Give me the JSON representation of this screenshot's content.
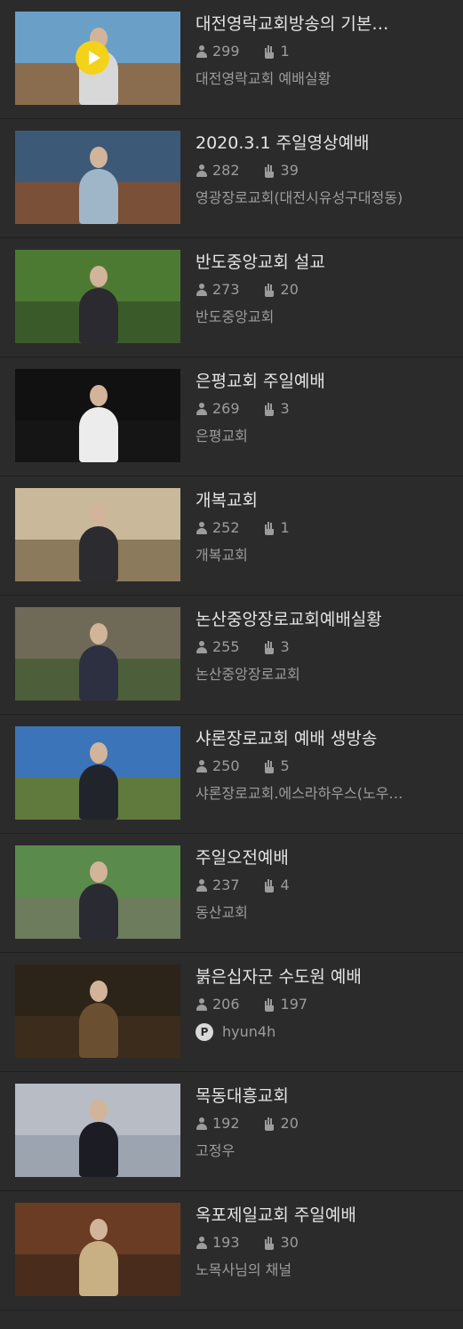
{
  "videos": [
    {
      "title": "대전영락교회방송의 기본…",
      "viewers": "299",
      "likes": "1",
      "channel": "대전영락교회 예배실황",
      "play": true,
      "colors": {
        "sky": "#6aa0c8",
        "ground": "#8a6d4e",
        "person": "#d8d8d8"
      }
    },
    {
      "title": "2020.3.1 주일영상예배",
      "viewers": "282",
      "likes": "39",
      "channel": "영광장로교회(대전시유성구대정동)",
      "colors": {
        "sky": "#3c5a78",
        "ground": "#7a5038",
        "person": "#9fb6c8"
      }
    },
    {
      "title": "반도중앙교회 설교",
      "viewers": "273",
      "likes": "20",
      "channel": "반도중앙교회",
      "colors": {
        "sky": "#4d7a32",
        "ground": "#3a5a2a",
        "person": "#2a2a30"
      }
    },
    {
      "title": "은평교회 주일예배",
      "viewers": "269",
      "likes": "3",
      "channel": "은평교회",
      "colors": {
        "sky": "#111111",
        "ground": "#151515",
        "person": "#ececec"
      }
    },
    {
      "title": "개복교회",
      "viewers": "252",
      "likes": "1",
      "channel": "개복교회",
      "colors": {
        "sky": "#c9b99a",
        "ground": "#8c7a5c",
        "person": "#2c2c30"
      }
    },
    {
      "title": "논산중앙장로교회예배실황",
      "viewers": "255",
      "likes": "3",
      "channel": "논산중앙장로교회",
      "colors": {
        "sky": "#6f6a58",
        "ground": "#4d5e3a",
        "person": "#2c3040"
      }
    },
    {
      "title": "샤론장로교회 예배 생방송",
      "viewers": "250",
      "likes": "5",
      "channel": "샤론장로교회.에스라하우스(노우…",
      "colors": {
        "sky": "#3b74b8",
        "ground": "#5f7a3c",
        "person": "#22242c"
      }
    },
    {
      "title": "주일오전예배",
      "viewers": "237",
      "likes": "4",
      "channel": "동산교회",
      "colors": {
        "sky": "#5a8a4c",
        "ground": "#6c7c5c",
        "person": "#2a2a32"
      }
    },
    {
      "title": "붉은십자군 수도원 예배",
      "viewers": "206",
      "likes": "197",
      "channel": "hyun4h",
      "avatar": "P",
      "colors": {
        "sky": "#2c2418",
        "ground": "#3c2c1c",
        "person": "#6a5030"
      }
    },
    {
      "title": "목동대흥교회",
      "viewers": "192",
      "likes": "20",
      "channel": "고정우",
      "colors": {
        "sky": "#b8bcc4",
        "ground": "#9ca4b0",
        "person": "#1c1c24"
      }
    },
    {
      "title": "옥포제일교회 주일예배",
      "viewers": "193",
      "likes": "30",
      "channel": "노목사님의 채널",
      "colors": {
        "sky": "#6a3c24",
        "ground": "#4a2c1c",
        "person": "#c8b084"
      }
    }
  ]
}
